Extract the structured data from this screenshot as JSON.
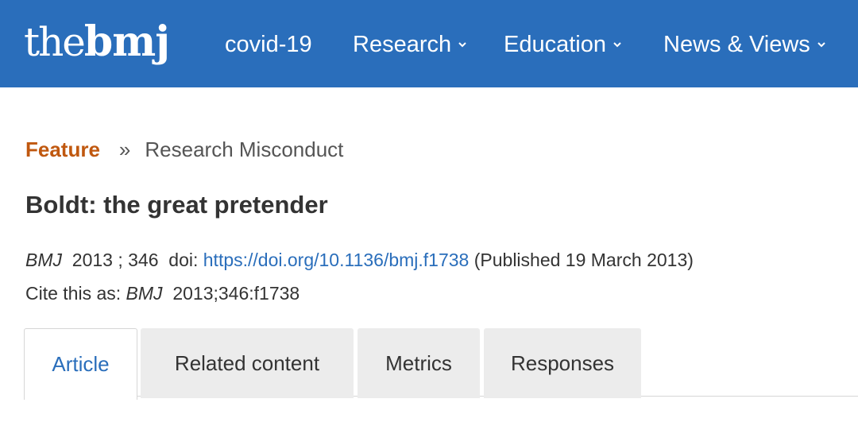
{
  "header": {
    "logo_the": "the",
    "logo_bmj": "bmj",
    "nav": [
      {
        "label": "covid-19",
        "has_dropdown": false
      },
      {
        "label": "Research",
        "has_dropdown": true
      },
      {
        "label": "Education",
        "has_dropdown": true
      },
      {
        "label": "News & Views",
        "has_dropdown": true
      }
    ]
  },
  "breadcrumb": {
    "type": "Feature",
    "separator": "»",
    "section": "Research Misconduct"
  },
  "article": {
    "title": "Boldt: the great pretender",
    "journal": "BMJ",
    "year": "2013",
    "volume_sep": ";",
    "volume": "346",
    "doi_label": "doi:",
    "doi_url": "https://doi.org/10.1136/bmj.f1738",
    "published": "(Published 19 March 2013)",
    "cite_label": "Cite this as:",
    "cite_journal": "BMJ",
    "cite_ref": "2013;346:f1738"
  },
  "tabs": [
    {
      "label": "Article",
      "active": true
    },
    {
      "label": "Related content",
      "active": false
    },
    {
      "label": "Metrics",
      "active": false
    },
    {
      "label": "Responses",
      "active": false
    }
  ],
  "colors": {
    "header_bg": "#2a6ebb",
    "link": "#2a6ebb",
    "feature_accent": "#c0580f",
    "tab_inactive_bg": "#ececec"
  }
}
